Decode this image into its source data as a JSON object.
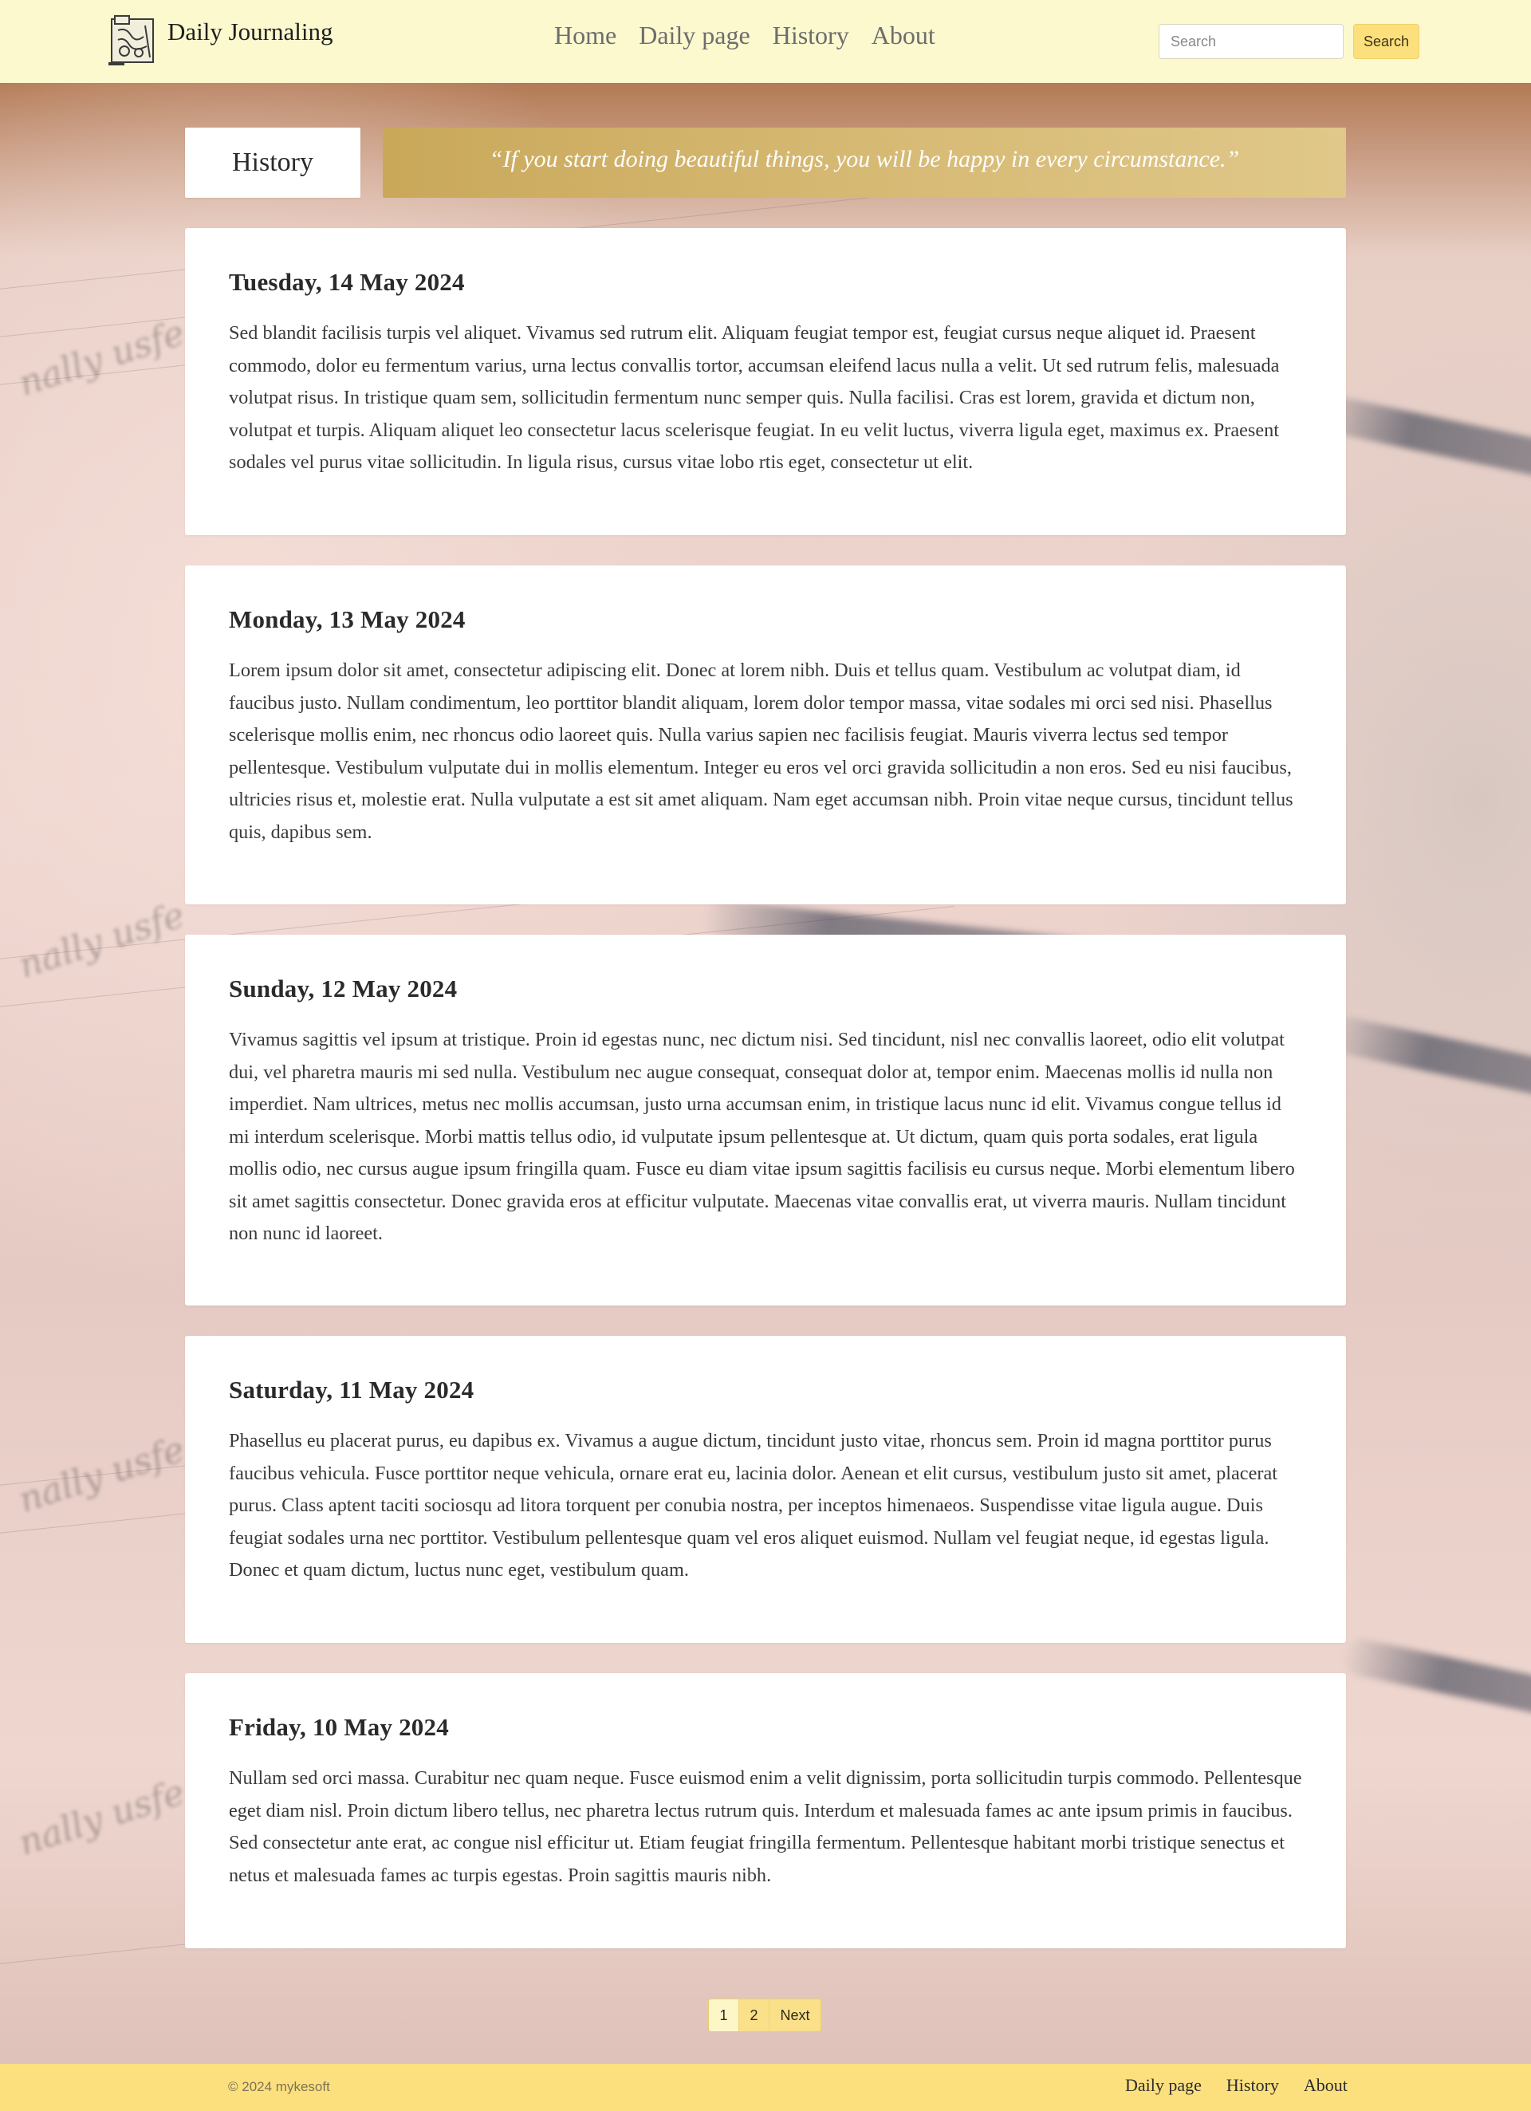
{
  "header": {
    "brand": "Daily Journaling",
    "nav": [
      "Home",
      "Daily page",
      "History",
      "About"
    ],
    "search_placeholder": "Search",
    "search_button": "Search"
  },
  "page": {
    "title": "History",
    "quote": "“If you start doing beautiful things, you will be happy in every circumstance.”"
  },
  "entries": [
    {
      "date": "Tuesday, 14 May 2024",
      "body": "Sed blandit facilisis turpis vel aliquet. Vivamus sed rutrum elit. Aliquam feugiat tempor est, feugiat cursus neque aliquet id. Praesent commodo, dolor eu fermentum varius, urna lectus convallis tortor, accumsan eleifend lacus nulla a velit. Ut sed rutrum felis, malesuada volutpat risus. In tristique quam sem, sollicitudin fermentum nunc semper quis. Nulla facilisi. Cras est lorem, gravida et dictum non, volutpat et turpis. Aliquam aliquet leo consectetur lacus scelerisque feugiat. In eu velit luctus, viverra ligula eget, maximus ex. Praesent sodales vel purus vitae sollicitudin. In ligula risus, cursus vitae lobo rtis eget, consectetur ut elit."
    },
    {
      "date": "Monday, 13 May 2024",
      "body": "Lorem ipsum dolor sit amet, consectetur adipiscing elit. Donec at lorem nibh. Duis et tellus quam. Vestibulum ac volutpat diam, id faucibus justo. Nullam condimentum, leo porttitor blandit aliquam, lorem dolor tempor massa, vitae sodales mi orci sed nisi. Phasellus scelerisque mollis enim, nec rhoncus odio laoreet quis. Nulla varius sapien nec facilisis feugiat. Mauris viverra lectus sed tempor pellentesque. Vestibulum vulputate dui in mollis elementum. Integer eu eros vel orci gravida sollicitudin a non eros. Sed eu nisi faucibus, ultricies risus et, molestie erat. Nulla vulputate a est sit amet aliquam. Nam eget accumsan nibh. Proin vitae neque cursus, tincidunt tellus quis, dapibus sem."
    },
    {
      "date": "Sunday, 12 May 2024",
      "body": "Vivamus sagittis vel ipsum at tristique. Proin id egestas nunc, nec dictum nisi. Sed tincidunt, nisl nec convallis laoreet, odio elit volutpat dui, vel pharetra mauris mi sed nulla. Vestibulum nec augue consequat, consequat dolor at, tempor enim. Maecenas mollis id nulla non imperdiet. Nam ultrices, metus nec mollis accumsan, justo urna accumsan enim, in tristique lacus nunc id elit. Vivamus congue tellus id mi interdum scelerisque. Morbi mattis tellus odio, id vulputate ipsum pellentesque at. Ut dictum, quam quis porta sodales, erat ligula mollis odio, nec cursus augue ipsum fringilla quam. Fusce eu diam vitae ipsum sagittis facilisis eu cursus neque. Morbi elementum libero sit amet sagittis consectetur. Donec gravida eros at efficitur vulputate. Maecenas vitae convallis erat, ut viverra mauris. Nullam tincidunt non nunc id laoreet."
    },
    {
      "date": "Saturday, 11 May 2024",
      "body": "Phasellus eu placerat purus, eu dapibus ex. Vivamus a augue dictum, tincidunt justo vitae, rhoncus sem. Proin id magna porttitor purus faucibus vehicula. Fusce porttitor neque vehicula, ornare erat eu, lacinia dolor. Aenean et elit cursus, vestibulum justo sit amet, placerat purus. Class aptent taciti sociosqu ad litora torquent per conubia nostra, per inceptos himenaeos. Suspendisse vitae ligula augue. Duis feugiat sodales urna nec porttitor. Vestibulum pellentesque quam vel eros aliquet euismod. Nullam vel feugiat neque, id egestas ligula. Donec et quam dictum, luctus nunc eget, vestibulum quam."
    },
    {
      "date": "Friday, 10 May 2024",
      "body": "Nullam sed orci massa. Curabitur nec quam neque. Fusce euismod enim a velit dignissim, porta sollicitudin turpis commodo. Pellentesque eget diam nisl. Proin dictum libero tellus, nec pharetra lectus rutrum quis. Interdum et malesuada fames ac ante ipsum primis in faucibus. Sed consectetur ante erat, ac congue nisl efficitur ut. Etiam feugiat fringilla fermentum. Pellentesque habitant morbi tristique senectus et netus et malesuada fames ac turpis egestas. Proin sagittis mauris nibh."
    }
  ],
  "pagination": {
    "pages": [
      "1",
      "2"
    ],
    "next": "Next"
  },
  "footer": {
    "copyright": "© 2024 mykesoft",
    "nav": [
      "Daily page",
      "History",
      "About"
    ]
  },
  "colors": {
    "header_bg": "#fcf9cf",
    "footer_bg": "#fde07e",
    "button_bg": "#fde07e",
    "quote_gold": "#d6b973"
  },
  "icons": [
    "journal-logo-icon"
  ]
}
